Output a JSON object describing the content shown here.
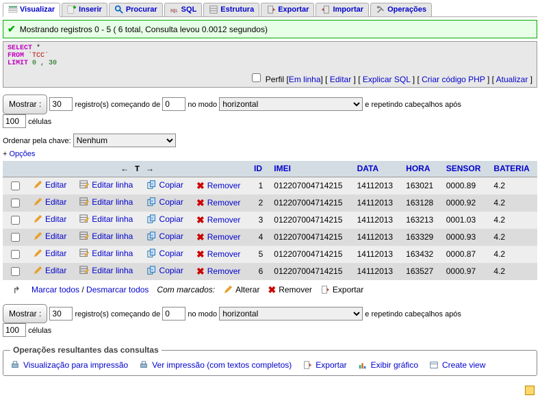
{
  "tabs": [
    {
      "label": "Visualizar",
      "active": true
    },
    {
      "label": "Inserir"
    },
    {
      "label": "Procurar"
    },
    {
      "label": "SQL"
    },
    {
      "label": "Estrutura"
    },
    {
      "label": "Exportar"
    },
    {
      "label": "Importar"
    },
    {
      "label": "Operações"
    }
  ],
  "success_message": "Mostrando registros 0 - 5 ( 6 total, Consulta levou 0.0012 segundos)",
  "sql": {
    "select": "SELECT",
    "star": "*",
    "from": "FROM",
    "table": "`TCC`",
    "limit": "LIMIT",
    "limit_vals": "0 , 30"
  },
  "inline_links": {
    "prefix": "Perfil [",
    "em_linha": "Em linha",
    "mid1": "] [ ",
    "editar": "Editar",
    "mid2": " ] [ ",
    "explicar": "Explicar SQL",
    "mid3": " ] [ ",
    "criar_php": "Criar código PHP",
    "mid4": " ] [ ",
    "atualizar": "Atualizar",
    "suffix": " ]",
    "profile_checkbox_label": ""
  },
  "controls": {
    "mostrar_btn": "Mostrar :",
    "rows_value": "30",
    "registros_label": "registro(s) começando de",
    "start_value": "0",
    "no_modo": "no modo",
    "mode_value": "horizontal",
    "repetindo": "e repetindo cabeçalhos após",
    "headers_value": "100",
    "celulas": "células"
  },
  "sortkey": {
    "label": "Ordenar pela chave:",
    "value": "Nenhum"
  },
  "options": {
    "plus": "+ ",
    "label": "Opções"
  },
  "arrow_cell": "← T →",
  "columns": [
    "ID",
    "IMEI",
    "DATA",
    "HORA",
    "SENSOR",
    "BATERIA"
  ],
  "row_actions": {
    "editar": "Editar",
    "editar_linha": "Editar linha",
    "copiar": "Copiar",
    "remover": "Remover"
  },
  "rows": [
    {
      "ID": "1",
      "IMEI": "012207004714215",
      "DATA": "14112013",
      "HORA": "163021",
      "SENSOR": "0000.89",
      "BATERIA": "4.2"
    },
    {
      "ID": "2",
      "IMEI": "012207004714215",
      "DATA": "14112013",
      "HORA": "163128",
      "SENSOR": "0000.92",
      "BATERIA": "4.2"
    },
    {
      "ID": "3",
      "IMEI": "012207004714215",
      "DATA": "14112013",
      "HORA": "163213",
      "SENSOR": "0001.03",
      "BATERIA": "4.2"
    },
    {
      "ID": "4",
      "IMEI": "012207004714215",
      "DATA": "14112013",
      "HORA": "163329",
      "SENSOR": "0000.93",
      "BATERIA": "4.2"
    },
    {
      "ID": "5",
      "IMEI": "012207004714215",
      "DATA": "14112013",
      "HORA": "163432",
      "SENSOR": "0000.87",
      "BATERIA": "4.2"
    },
    {
      "ID": "6",
      "IMEI": "012207004714215",
      "DATA": "14112013",
      "HORA": "163527",
      "SENSOR": "0000.97",
      "BATERIA": "4.2"
    }
  ],
  "marks": {
    "marcar": "Marcar todos",
    "slash": " / ",
    "desmarcar": "Desmarcar todos",
    "com_marcados": "Com marcados:",
    "alterar": "Alterar",
    "remover": "Remover",
    "exportar": "Exportar"
  },
  "ops_fieldset": {
    "legend": "Operações resultantes das consultas",
    "visual_impressao": "Visualização para impressão",
    "ver_impressao": "Ver impressão (com textos completos)",
    "exportar": "Exportar",
    "exibir_grafico": "Exibir gráfico",
    "create_view": "Create view"
  }
}
